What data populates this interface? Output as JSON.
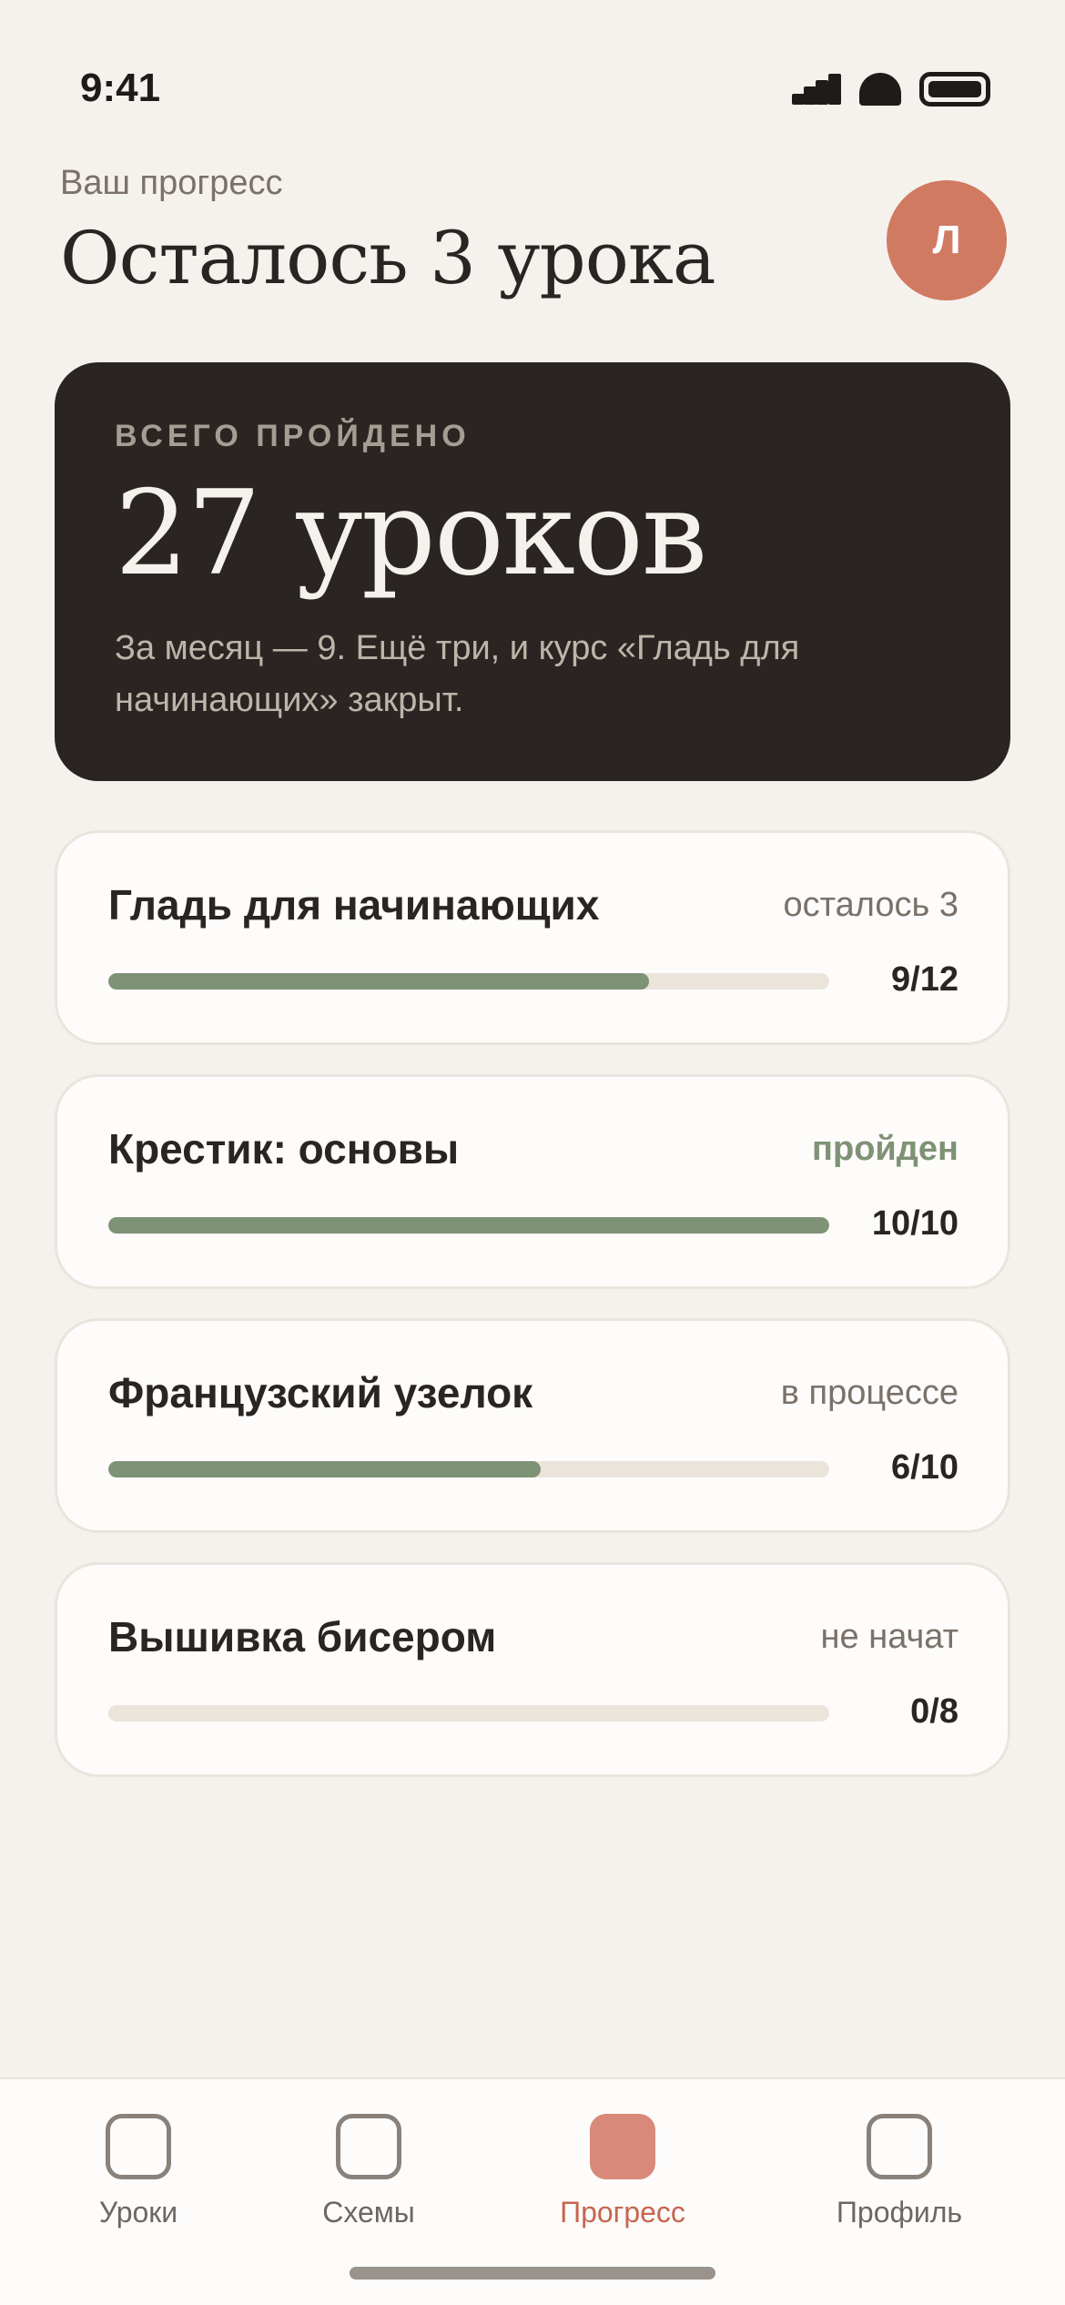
{
  "status_bar": {
    "time": "9:41"
  },
  "header": {
    "subtitle": "Ваш прогресс",
    "title": "Осталось 3 урока",
    "avatar_initial": "Л"
  },
  "summary": {
    "caption": "ВСЕГО ПРОЙДЕНО",
    "count": "27 уроков",
    "description": "За месяц — 9. Ещё три, и курс «Гладь для начинающих» закрыт."
  },
  "courses": [
    {
      "name": "Гладь для начинающих",
      "status": "осталось 3",
      "count": "9/12",
      "progress": 0.75
    },
    {
      "name": "Крестик: основы",
      "status": "пройден",
      "count": "10/10",
      "progress": 1.0
    },
    {
      "name": "Французский узелок",
      "status": "в процессе",
      "count": "6/10",
      "progress": 0.6
    },
    {
      "name": "Вышивка бисером",
      "status": "не начат",
      "count": "0/8",
      "progress": 0.0
    }
  ],
  "tabs": [
    {
      "label": "Уроки",
      "icon": "lessons-icon",
      "active": false
    },
    {
      "label": "Схемы",
      "icon": "patterns-icon",
      "active": false
    },
    {
      "label": "Прогресс",
      "icon": "progress-icon",
      "active": true
    },
    {
      "label": "Профиль",
      "icon": "profile-icon",
      "active": false
    }
  ],
  "colors": {
    "background": "#F5F1EC",
    "accent": "#D07A62",
    "progress": "#7E9275",
    "dark_card": "#2A2522"
  }
}
